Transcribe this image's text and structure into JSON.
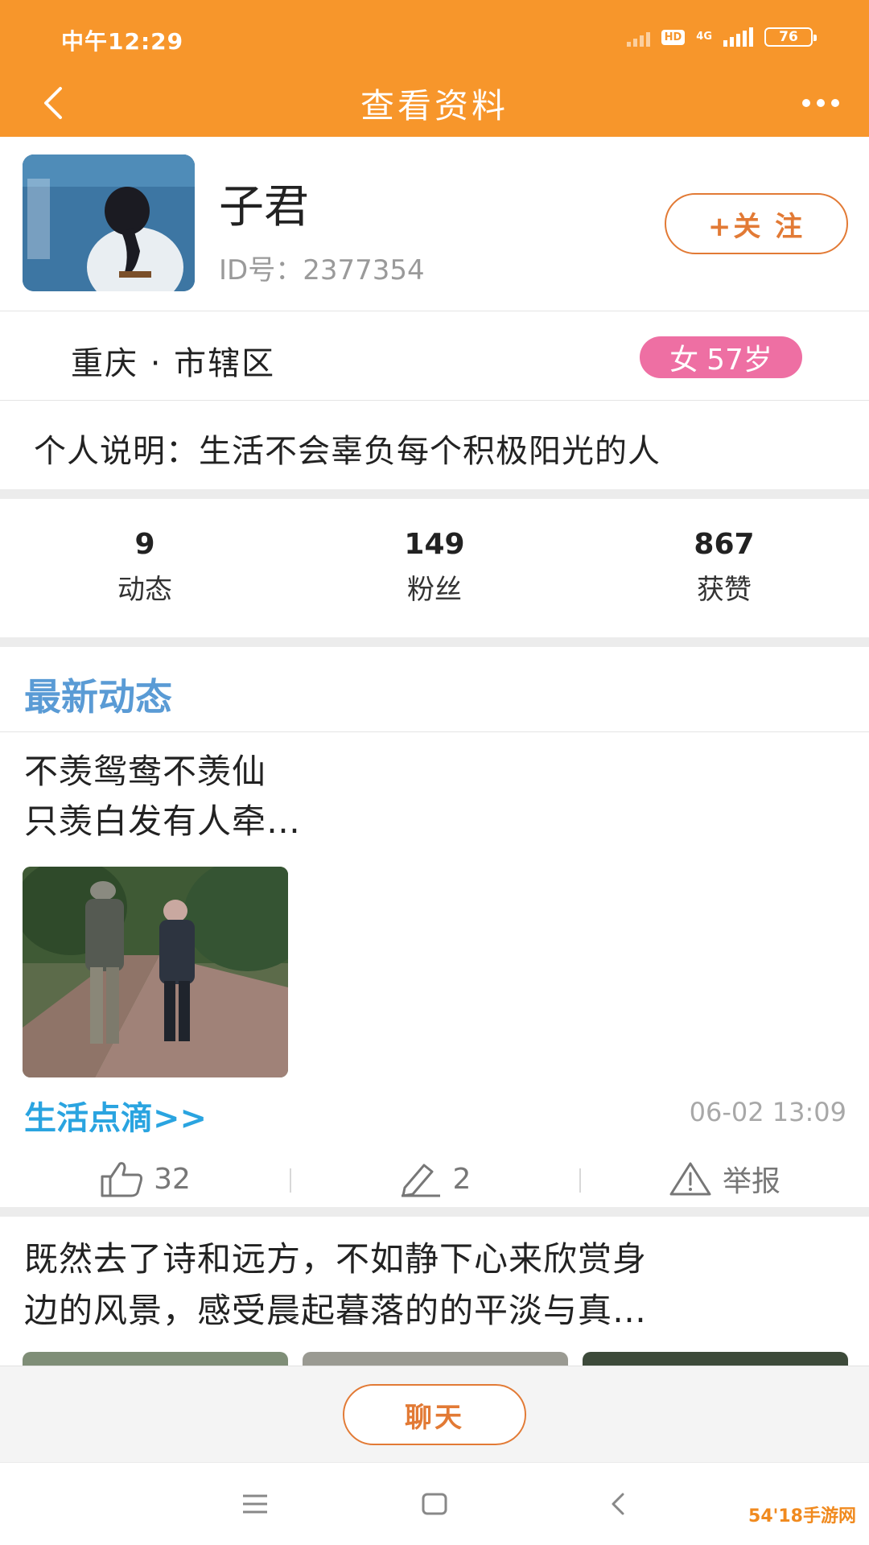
{
  "status_bar": {
    "time": "中午12:29",
    "hd": "HD",
    "network": "4G",
    "battery": "76"
  },
  "header": {
    "title": "查看资料"
  },
  "profile": {
    "name": "子君",
    "id_text": "ID号：2377354",
    "follow_label": "+关 注",
    "location": "重庆 · 市辖区",
    "gender": "女",
    "age": "57岁",
    "bio": "个人说明：生活不会辜负每个积极阳光的人"
  },
  "stats": [
    {
      "value": "9",
      "label": "动态"
    },
    {
      "value": "149",
      "label": "粉丝"
    },
    {
      "value": "867",
      "label": "获赞"
    }
  ],
  "feed": {
    "section_title": "最新动态",
    "posts": [
      {
        "lines": [
          "不羡鸳鸯不羡仙",
          "只羡白发有人牵…"
        ],
        "topic": "生活点滴>>",
        "time": "06-02 13:09",
        "likes": "32",
        "comments": "2",
        "report_label": "举报"
      },
      {
        "lines": [
          "既然去了诗和远方，不如静下心来欣赏身",
          "边的风景，感受晨起暮落的的平淡与真…"
        ]
      }
    ]
  },
  "bottom": {
    "chat_label": "聊天"
  },
  "colors": {
    "accent": "#f7962b",
    "follow": "#e27a35",
    "section_title": "#5a9bd5",
    "topic": "#2aa4e0",
    "gender_badge": "#ee6fa3"
  },
  "watermark": "54'18手游网"
}
